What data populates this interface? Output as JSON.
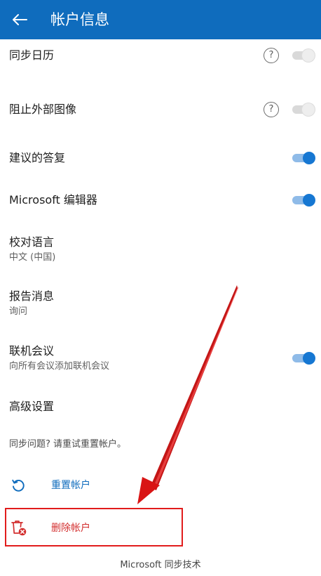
{
  "header": {
    "title": "帐户信息",
    "bg_color": "#0f6cbd"
  },
  "settings": {
    "sync_calendar": {
      "label": "同步日历",
      "enabled": false
    },
    "block_external_images": {
      "label": "阻止外部图像",
      "enabled": false
    },
    "suggested_replies": {
      "label": "建议的答复",
      "enabled": true
    },
    "editor": {
      "label": "Microsoft 编辑器",
      "enabled": true
    },
    "proofing_language": {
      "label": "校对语言",
      "value": "中文 (中国)"
    },
    "report_message": {
      "label": "报告消息",
      "value": "询问"
    },
    "online_meeting": {
      "label": "联机会议",
      "value": "向所有会议添加联机会议",
      "enabled": true
    },
    "advanced": {
      "label": "高级设置"
    }
  },
  "sync_problem_text": "同步问题? 请重试重置帐户。",
  "actions": {
    "reset": {
      "label": "重置帐户",
      "color": "#0f6cbd"
    },
    "delete": {
      "label": "删除帐户",
      "color": "#d32f2f"
    }
  },
  "footer": "Microsoft 同步技术",
  "help_glyph": "?"
}
